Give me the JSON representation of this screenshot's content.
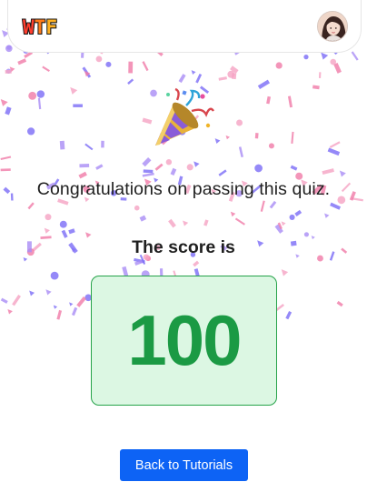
{
  "header": {
    "logo_letters": [
      "W",
      "T",
      "F"
    ],
    "avatar": "user-avatar"
  },
  "main": {
    "celebration_icon": "party-popper-icon",
    "congrats_text": "Congratulations on passing this quiz.",
    "score_label": "The score is",
    "score_value": "100",
    "back_button_label": "Back to Tutorials"
  },
  "colors": {
    "score_text": "#1b9a44",
    "score_bg": "#dcf7e3",
    "score_border": "#26a34a",
    "button_bg": "#0d63f5",
    "confetti": [
      "#7b6cf6",
      "#f07aa8",
      "#a98cf5",
      "#f5a3c3"
    ]
  }
}
